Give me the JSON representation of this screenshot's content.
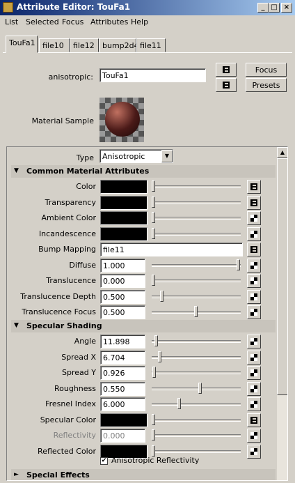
{
  "window": {
    "title": "Attribute Editor: TouFa1",
    "controls": [
      "_",
      "□",
      "×"
    ]
  },
  "menu": [
    "List",
    "Selected",
    "Focus",
    "Attributes",
    "Help"
  ],
  "tabs": [
    "TouFa1",
    "file10",
    "file12",
    "bump2d4",
    "file11"
  ],
  "header": {
    "node_label": "anisotropic:",
    "node_name": "TouFa1",
    "focus_label": "Focus",
    "presets_label": "Presets",
    "material_sample_label": "Material Sample"
  },
  "type_row": {
    "label": "Type",
    "value": "Anisotropic"
  },
  "sections": {
    "common": {
      "title": "Common Material Attributes",
      "rows": [
        {
          "label": "Color",
          "kind": "color",
          "slider": 0.0,
          "map": "link"
        },
        {
          "label": "Transparency",
          "kind": "color",
          "slider": 0.0,
          "map": "link"
        },
        {
          "label": "Ambient Color",
          "kind": "color",
          "slider": 0.0,
          "map": "checker"
        },
        {
          "label": "Incandescence",
          "kind": "color",
          "slider": 0.0,
          "map": "checker"
        },
        {
          "label": "Bump Mapping",
          "kind": "text",
          "value": "file11",
          "map": "link"
        },
        {
          "label": "Diffuse",
          "kind": "num",
          "value": "1.000",
          "slider": 1.0,
          "map": "checker"
        },
        {
          "label": "Translucence",
          "kind": "num",
          "value": "0.000",
          "slider": 0.0,
          "map": "checker"
        },
        {
          "label": "Translucence Depth",
          "kind": "num",
          "value": "0.500",
          "slider": 0.1,
          "map": "checker"
        },
        {
          "label": "Translucence Focus",
          "kind": "num",
          "value": "0.500",
          "slider": 0.5,
          "map": "checker"
        }
      ]
    },
    "specular": {
      "title": "Specular Shading",
      "rows": [
        {
          "label": "Angle",
          "kind": "num",
          "value": "11.898",
          "slider": 0.03,
          "map": "checker"
        },
        {
          "label": "Spread X",
          "kind": "num",
          "value": "6.704",
          "slider": 0.07,
          "map": "checker"
        },
        {
          "label": "Spread Y",
          "kind": "num",
          "value": "0.926",
          "slider": 0.01,
          "map": "checker"
        },
        {
          "label": "Roughness",
          "kind": "num",
          "value": "0.550",
          "slider": 0.55,
          "map": "checker"
        },
        {
          "label": "Fresnel Index",
          "kind": "num",
          "value": "6.000",
          "slider": 0.3,
          "map": "checker"
        },
        {
          "label": "Specular Color",
          "kind": "color",
          "slider": 0.0,
          "map": "link"
        },
        {
          "label": "Reflectivity",
          "kind": "num",
          "value": "0.000",
          "slider": 0.0,
          "map": "checker",
          "disabled": true
        },
        {
          "label": "Reflected Color",
          "kind": "color",
          "slider": 0.0,
          "map": "checker"
        }
      ],
      "checkbox_label": "Anisotropic Reflectivity",
      "checkbox_checked": true
    },
    "special": {
      "title": "Special Effects"
    }
  }
}
